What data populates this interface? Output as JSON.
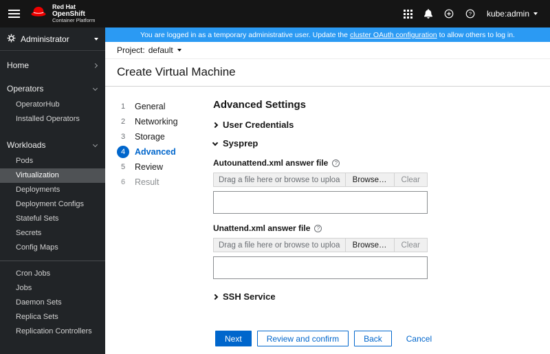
{
  "masthead": {
    "brand": {
      "line1": "Red Hat",
      "line2": "OpenShift",
      "line3": "Container Platform"
    },
    "user": "kube:admin"
  },
  "banner": {
    "text_before": "You are logged in as a temporary administrative user. Update the",
    "link_text": "cluster OAuth configuration",
    "text_after": "to allow others to log in."
  },
  "sidebar": {
    "perspective": "Administrator",
    "home_label": "Home",
    "operators": {
      "label": "Operators",
      "items": [
        "OperatorHub",
        "Installed Operators"
      ]
    },
    "workloads": {
      "label": "Workloads",
      "items": [
        "Pods",
        "Virtualization",
        "Deployments",
        "Deployment Configs",
        "Stateful Sets",
        "Secrets",
        "Config Maps",
        "Cron Jobs",
        "Jobs",
        "Daemon Sets",
        "Replica Sets",
        "Replication Controllers"
      ],
      "active_item": "Virtualization"
    }
  },
  "project_bar": {
    "label": "Project:",
    "value": "default"
  },
  "page": {
    "title": "Create Virtual Machine"
  },
  "wizard": {
    "steps": [
      {
        "num": "1",
        "label": "General"
      },
      {
        "num": "2",
        "label": "Networking"
      },
      {
        "num": "3",
        "label": "Storage"
      },
      {
        "num": "4",
        "label": "Advanced",
        "active": true
      },
      {
        "num": "5",
        "label": "Review"
      },
      {
        "num": "6",
        "label": "Result",
        "disabled": true
      }
    ]
  },
  "content": {
    "heading": "Advanced Settings",
    "sections": {
      "user_credentials": "User Credentials",
      "sysprep": "Sysprep",
      "ssh_service": "SSH Service"
    },
    "fields": [
      {
        "label": "Autounattend.xml answer file",
        "placeholder": "Drag a file here or browse to upload",
        "browse_label": "Browse…",
        "clear_label": "Clear"
      },
      {
        "label": "Unattend.xml answer file",
        "placeholder": "Drag a file here or browse to upload",
        "browse_label": "Browse…",
        "clear_label": "Clear"
      }
    ]
  },
  "footer": {
    "next_label": "Next",
    "review_label": "Review and confirm",
    "back_label": "Back",
    "cancel_label": "Cancel"
  },
  "colors": {
    "primary": "#0066cc",
    "banner_bg": "#2b9af3",
    "masthead_bg": "#151515",
    "sidebar_bg": "#212427",
    "active_nav_bg": "#4f5255"
  }
}
